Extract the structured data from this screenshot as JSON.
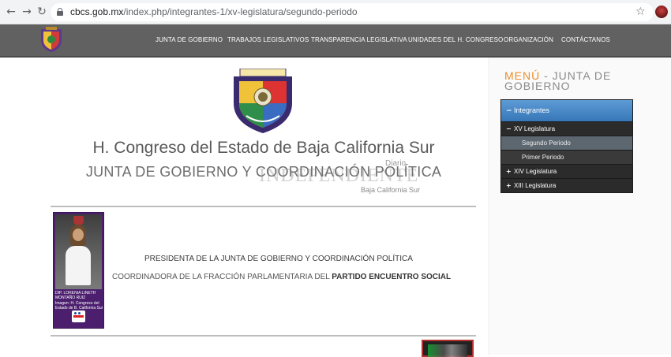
{
  "browser": {
    "url_host": "cbcs.gob.mx",
    "url_path": "/index.php/integrantes-1/xv-legislatura/segundo-periodo",
    "back_icon": "←",
    "forward_icon": "→",
    "reload_icon": "↻",
    "star_icon": "☆"
  },
  "nav": {
    "items": [
      "JUNTA DE GOBIERNO",
      "TRABAJOS LEGISLATIVOS",
      "TRANSPARENCIA LEGISLATIVA",
      "UNIDADES DEL H. CONGRESO",
      "ORGANIZACIÓN",
      "CONTÁCTANOS"
    ]
  },
  "main": {
    "title": "H. Congreso del Estado de Baja California Sur",
    "subtitle": "JUNTA DE GOBIERNO Y COORDINACIÓN POLÍTICA",
    "watermark": {
      "small": "Diario",
      "big": "INDEPENDIENTE",
      "region": "Baja California Sur"
    },
    "profile_card": {
      "name_line1": "DIP. LORENIA LINETH",
      "name_line2": "MONTAÑO RUIZ",
      "credit_line1": "Imagen: H. Congreso del",
      "credit_line2": "Estado de B. California Sur"
    },
    "role_line1": "PRESIDENTA DE LA JUNTA DE GOBIERNO Y COORDINACIÓN POLÍTICA",
    "role_line2_prefix": "COORDINADORA DE LA FRACCIÓN PARLAMENTARIA DEL ",
    "role_line2_party": "PARTIDO ENCUENTRO SOCIAL"
  },
  "sidebar": {
    "heading_accent": "MENÚ",
    "heading_rest": " - JUNTA DE GOBIERNO",
    "menu": {
      "header": "Integrantes",
      "header_symbol": "−",
      "items": [
        {
          "label": "XV Legislatura",
          "symbol": "−"
        },
        {
          "label": "Segundo Periodo",
          "symbol": ""
        },
        {
          "label": "Primer Periodo",
          "symbol": ""
        },
        {
          "label": "XIV Legislatura",
          "symbol": "+"
        },
        {
          "label": "XIII Legislatura",
          "symbol": "+"
        }
      ]
    }
  },
  "colors": {
    "nav_bg": "#616161",
    "accent_orange": "#e98f2a",
    "menu_blue": "#3777b8",
    "card_purple": "#4b1f6e"
  }
}
